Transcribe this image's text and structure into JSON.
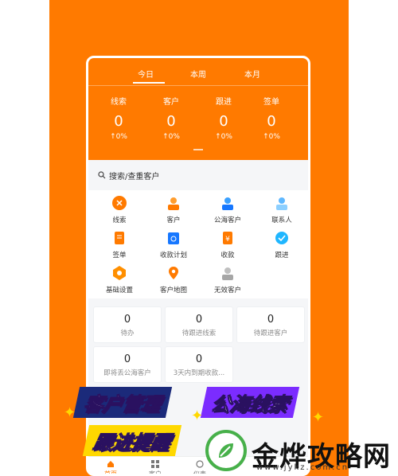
{
  "tabs": [
    "今日",
    "本周",
    "本月"
  ],
  "stats": [
    {
      "label": "线索",
      "value": "0",
      "change": "↑0%"
    },
    {
      "label": "客户",
      "value": "0",
      "change": "↑0%"
    },
    {
      "label": "跟进",
      "value": "0",
      "change": "↑0%"
    },
    {
      "label": "签单",
      "value": "0",
      "change": "↑0%"
    }
  ],
  "search": {
    "label": "搜索/查重客户",
    "icon": "search-icon"
  },
  "grid": [
    {
      "label": "线索",
      "icon": "lead-icon"
    },
    {
      "label": "客户",
      "icon": "customer-icon"
    },
    {
      "label": "公海客户",
      "icon": "public-customer-icon"
    },
    {
      "label": "联系人",
      "icon": "contact-icon"
    },
    {
      "label": "签单",
      "icon": "contract-icon"
    },
    {
      "label": "收款计划",
      "icon": "payment-plan-icon"
    },
    {
      "label": "收款",
      "icon": "payment-icon"
    },
    {
      "label": "跟进",
      "icon": "follow-up-icon"
    },
    {
      "label": "基础设置",
      "icon": "settings-icon"
    },
    {
      "label": "客户地图",
      "icon": "map-icon"
    },
    {
      "label": "无效客户",
      "icon": "invalid-customer-icon"
    }
  ],
  "metrics": [
    {
      "value": "0",
      "label": "待办"
    },
    {
      "value": "0",
      "label": "待跟进线索"
    },
    {
      "value": "0",
      "label": "待跟进客户"
    },
    {
      "value": "0",
      "label": "即将丢公海客户"
    },
    {
      "value": "0",
      "label": "3天内到期收款..."
    }
  ],
  "bottom_nav": [
    {
      "label": "首页",
      "active": true
    },
    {
      "label": "客户",
      "active": false
    },
    {
      "label": "仪表",
      "active": false
    }
  ],
  "banners": {
    "customer_management": "客户管理",
    "public_leads": "公海线索",
    "follow_reminder": "跟进提醒"
  },
  "watermark": {
    "name": "金烨攻略网",
    "url": "www.jykz.com.cn"
  },
  "colors": {
    "brand_orange": "#ff7a00",
    "white": "#ffffff",
    "banner_yellow": "#ffd800",
    "banner_purple": "#7b2cff",
    "watermark_green": "#47b04a"
  }
}
